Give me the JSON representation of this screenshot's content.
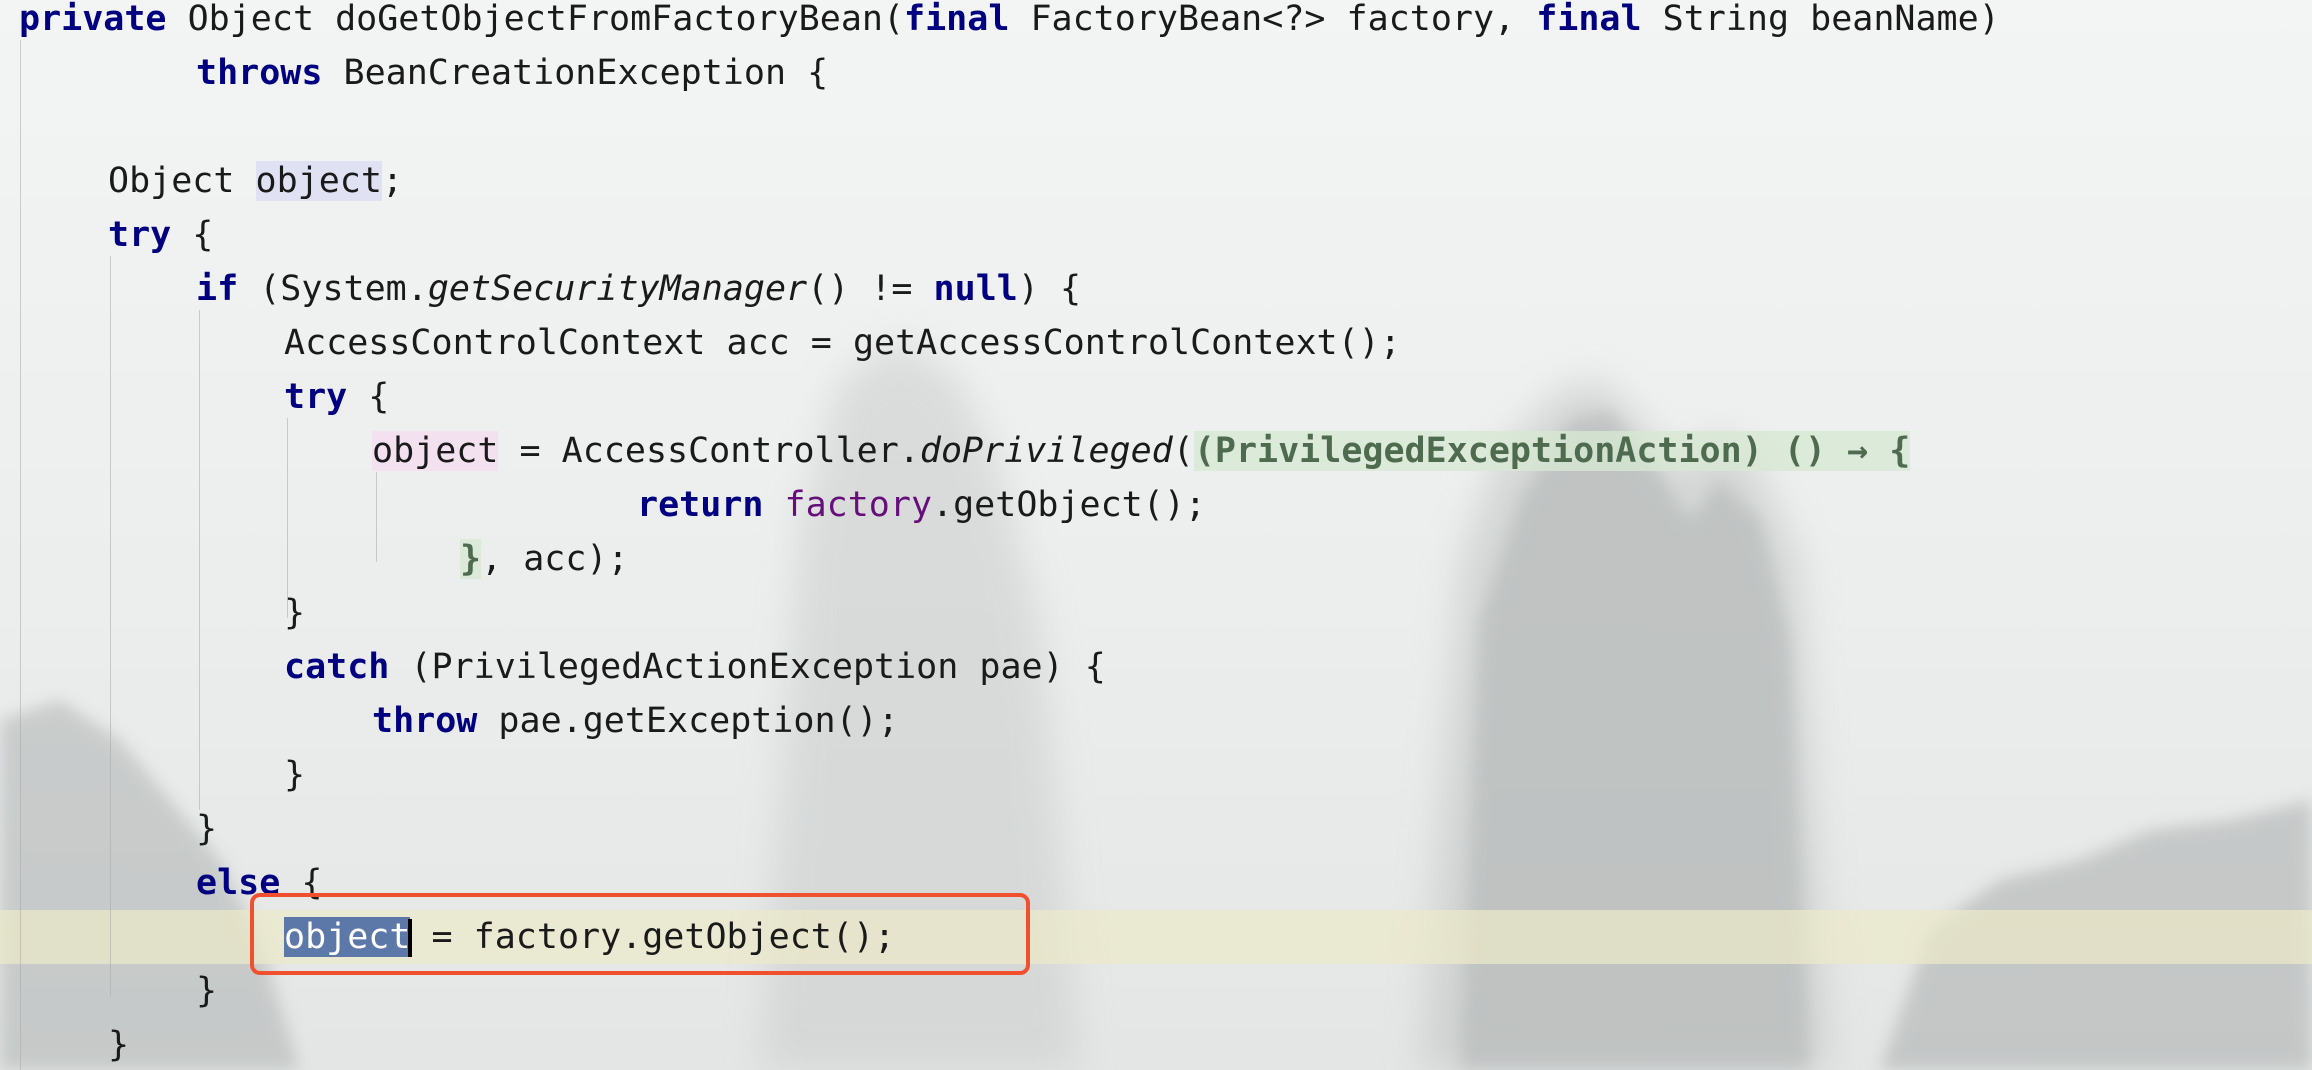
{
  "editor": {
    "lines": [
      {
        "segments": [
          {
            "text": "private",
            "cls": "kw"
          },
          {
            "text": " Object doGetObjectFromFactoryBean("
          },
          {
            "text": "final",
            "cls": "kw"
          },
          {
            "text": " FactoryBean<?> factory, "
          },
          {
            "text": "final",
            "cls": "kw"
          },
          {
            "text": " String beanName)"
          }
        ]
      },
      {
        "segments": [
          {
            "text": "throws",
            "cls": "kw"
          },
          {
            "text": " BeanCreationException {"
          }
        ]
      },
      {
        "segments": []
      },
      {
        "segments": [
          {
            "text": "Object "
          },
          {
            "text": "object",
            "cls": "usage-read"
          },
          {
            "text": ";"
          }
        ]
      },
      {
        "segments": [
          {
            "text": "try",
            "cls": "kw"
          },
          {
            "text": " {"
          }
        ]
      },
      {
        "segments": [
          {
            "text": "if",
            "cls": "kw"
          },
          {
            "text": " (System."
          },
          {
            "text": "getSecurityManager",
            "cls": "it"
          },
          {
            "text": "() != "
          },
          {
            "text": "null",
            "cls": "kw"
          },
          {
            "text": ") {"
          }
        ]
      },
      {
        "segments": [
          {
            "text": "AccessControlContext acc = getAccessControlContext();"
          }
        ]
      },
      {
        "segments": [
          {
            "text": "try",
            "cls": "kw"
          },
          {
            "text": " {"
          }
        ]
      },
      {
        "segments": [
          {
            "text": "object",
            "cls": "usage-write"
          },
          {
            "text": " = AccessController."
          },
          {
            "text": "doPrivileged",
            "cls": "it"
          },
          {
            "text": "("
          },
          {
            "text": "(PrivilegedExceptionAction) () → {",
            "cls": "fold lambda-bg"
          }
        ]
      },
      {
        "segments": [
          {
            "text": "return",
            "cls": "kw"
          },
          {
            "text": " "
          },
          {
            "text": "factory",
            "cls": "field"
          },
          {
            "text": ".getObject();"
          }
        ]
      },
      {
        "segments": [
          {
            "text": "}",
            "cls": "fold lambda-bg"
          },
          {
            "text": ", acc);"
          }
        ]
      },
      {
        "segments": [
          {
            "text": "}"
          }
        ]
      },
      {
        "segments": [
          {
            "text": "catch",
            "cls": "kw"
          },
          {
            "text": " (PrivilegedActionException pae) {"
          }
        ]
      },
      {
        "segments": [
          {
            "text": "throw",
            "cls": "kw"
          },
          {
            "text": " pae.getException();"
          }
        ]
      },
      {
        "segments": [
          {
            "text": "}"
          }
        ]
      },
      {
        "segments": [
          {
            "text": "}"
          }
        ]
      },
      {
        "segments": [
          {
            "text": "else",
            "cls": "kw"
          },
          {
            "text": " {"
          }
        ]
      },
      {
        "segments": [
          {
            "text": "object",
            "cls": "selection"
          },
          {
            "caret": true
          },
          {
            "text": " = factory.getObject();"
          }
        ]
      },
      {
        "segments": [
          {
            "text": "}"
          }
        ]
      },
      {
        "segments": [
          {
            "text": "}"
          }
        ]
      }
    ],
    "current_line_index": 17,
    "highlighted_line_index": 17
  },
  "colors": {
    "keyword": "#000080",
    "field": "#660e7a",
    "selection": "#5c78a8",
    "current_line": "#ece9c8",
    "highlight_box": "#f0502d"
  }
}
